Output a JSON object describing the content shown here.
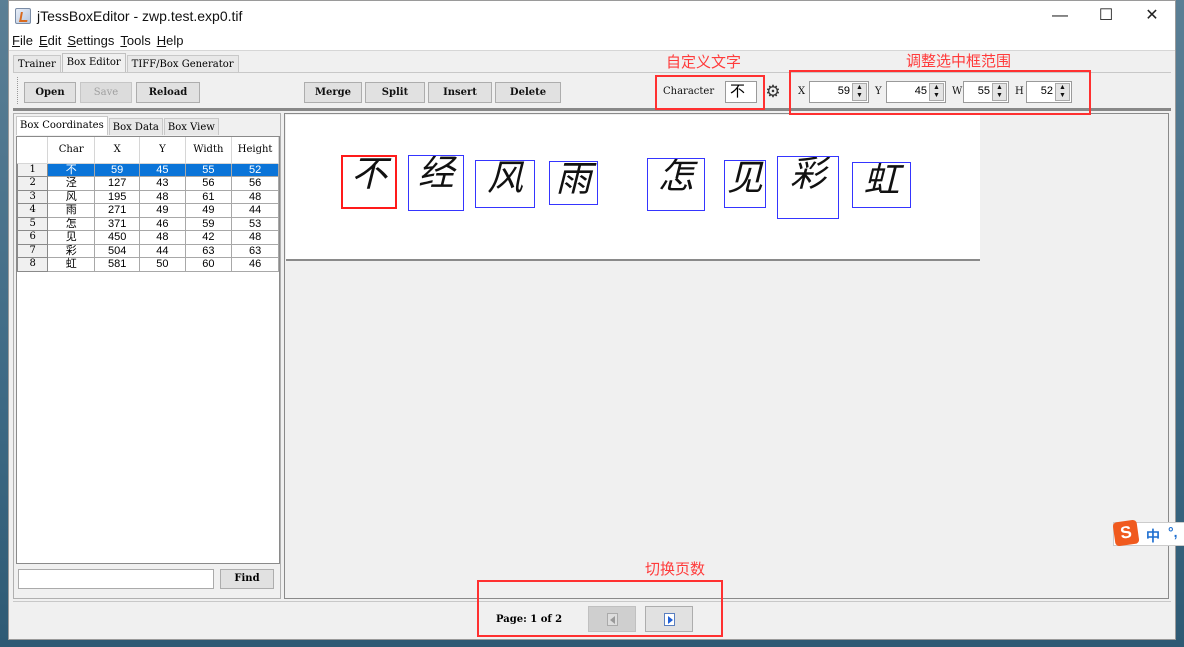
{
  "window": {
    "title": "jTessBoxEditor - zwp.test.exp0.tif",
    "controls": {
      "minimize": "—",
      "maximize": "☐",
      "close": "✕"
    }
  },
  "menu": [
    {
      "u": "F",
      "rest": "ile"
    },
    {
      "u": "E",
      "rest": "dit"
    },
    {
      "u": "S",
      "rest": "ettings"
    },
    {
      "u": "T",
      "rest": "ools"
    },
    {
      "u": "H",
      "rest": "elp"
    }
  ],
  "main_tabs": [
    "Trainer",
    "Box Editor",
    "TIFF/Box Generator"
  ],
  "toolbar": {
    "open": "Open",
    "save": "Save",
    "reload": "Reload",
    "merge": "Merge",
    "split": "Split",
    "insert": "Insert",
    "delete": "Delete",
    "character_label": "Character",
    "character_value": "不",
    "x_label": "X",
    "x_value": "59",
    "y_label": "Y",
    "y_value": "45",
    "w_label": "W",
    "w_value": "55",
    "h_label": "H",
    "h_value": "52"
  },
  "sub_tabs": [
    "Box Coordinates",
    "Box Data",
    "Box View"
  ],
  "table": {
    "headers": [
      "Char",
      "X",
      "Y",
      "Width",
      "Height"
    ],
    "rows": [
      {
        "n": "1",
        "char": "不",
        "x": "59",
        "y": "45",
        "w": "55",
        "h": "52"
      },
      {
        "n": "2",
        "char": "泾",
        "x": "127",
        "y": "43",
        "w": "56",
        "h": "56"
      },
      {
        "n": "3",
        "char": "风",
        "x": "195",
        "y": "48",
        "w": "61",
        "h": "48"
      },
      {
        "n": "4",
        "char": "雨",
        "x": "271",
        "y": "49",
        "w": "49",
        "h": "44"
      },
      {
        "n": "5",
        "char": "怎",
        "x": "371",
        "y": "46",
        "w": "59",
        "h": "53"
      },
      {
        "n": "6",
        "char": "见",
        "x": "450",
        "y": "48",
        "w": "42",
        "h": "48"
      },
      {
        "n": "7",
        "char": "彩",
        "x": "504",
        "y": "44",
        "w": "63",
        "h": "63"
      },
      {
        "n": "8",
        "char": "虹",
        "x": "581",
        "y": "50",
        "w": "60",
        "h": "46"
      }
    ],
    "selected_row": 1
  },
  "find": {
    "value": "",
    "button": "Find"
  },
  "viewer": {
    "glyphs": [
      "不",
      "经",
      "风",
      "雨",
      "怎",
      "见",
      "彩",
      "虹"
    ]
  },
  "pager": {
    "label": "Page: 1 of 2"
  },
  "annotations": {
    "character": "自定义文字",
    "coords": "调整选中框范围",
    "pages": "切换页数"
  },
  "ime": {
    "logo": "S",
    "mode": "中",
    "punct": "°,"
  },
  "colors": {
    "selection": "#0a74d8",
    "selected_box": "#ff1a1a",
    "box": "#3535ff",
    "annotation": "#ff3030"
  }
}
